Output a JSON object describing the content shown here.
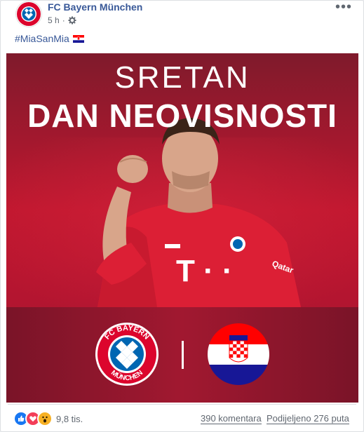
{
  "post": {
    "page_name": "FC Bayern München",
    "time": "5 h",
    "separator": "·",
    "privacy_icon": "gear-icon",
    "text": "#MiaSanMia",
    "flag_emoji": "croatia-flag-icon"
  },
  "image": {
    "line1": "SRETAN",
    "line2": "DAN NEOVISNOSTI",
    "divider": "|",
    "logo_text_top": "FC BAYERN",
    "logo_text_bottom": "MÜNCHEN",
    "shirt_sponsor": "T · ·"
  },
  "footer": {
    "reaction_count": "9,8 tis.",
    "comments": "390 komentara",
    "shares": "Podijeljeno 276 puta"
  },
  "colors": {
    "link": "#385898",
    "bayern_red": "#dc052d",
    "bayern_blue": "#0066b2"
  }
}
